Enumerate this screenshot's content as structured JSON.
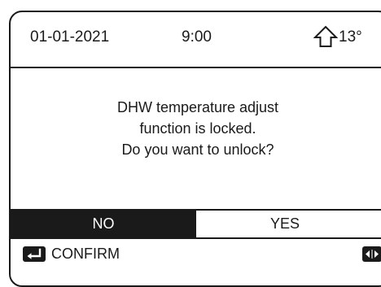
{
  "status_bar": {
    "date": "01-01-2021",
    "time": "9:00",
    "outdoor_icon": "house-outline-icon",
    "outdoor_temperature": "13°"
  },
  "dialog": {
    "line1": "DHW temperature adjust",
    "line2": "function is locked.",
    "line3": "Do you want to unlock?"
  },
  "choices": {
    "no_label": "NO",
    "yes_label": "YES",
    "selected": "NO"
  },
  "footer": {
    "confirm_icon": "enter-key-icon",
    "confirm_label": "CONFIRM",
    "navigate_icon": "left-right-arrows-icon"
  },
  "colors": {
    "foreground": "#1a1a1a",
    "background": "#ffffff"
  }
}
